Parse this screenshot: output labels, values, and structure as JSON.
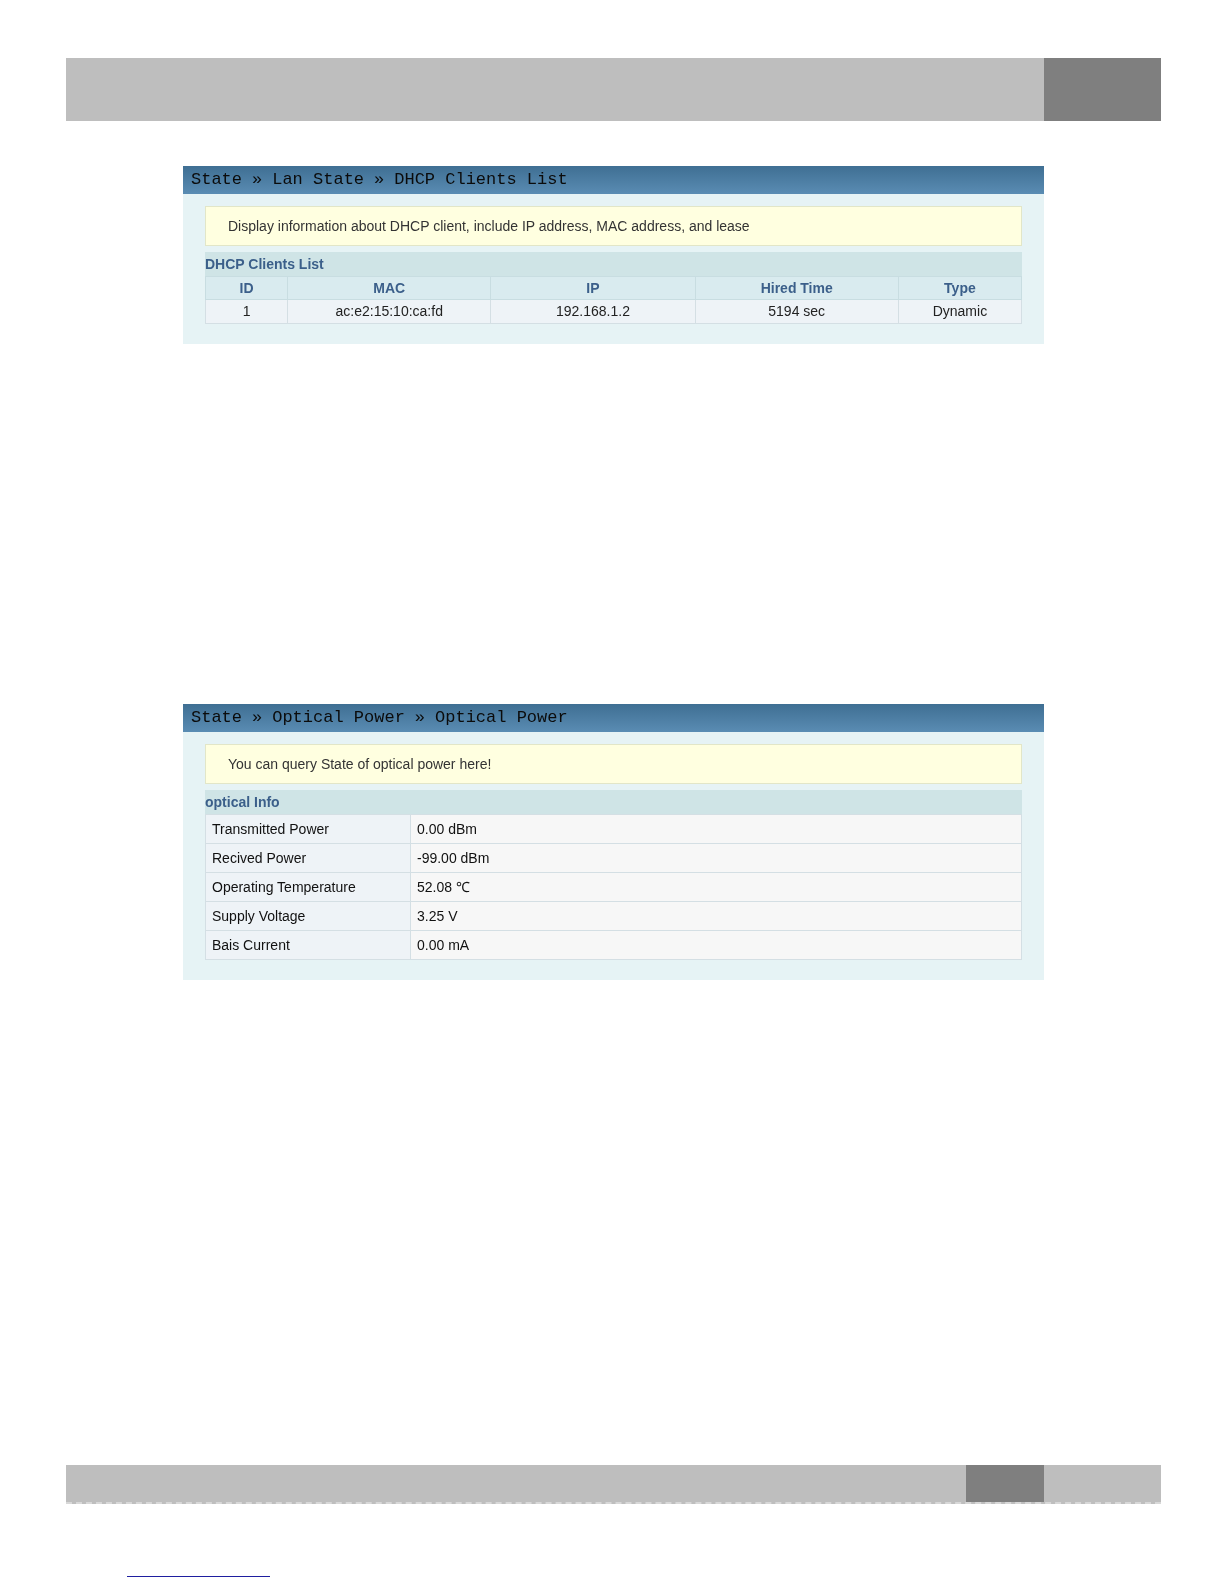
{
  "panels": [
    {
      "kind": "table",
      "breadcrumb": [
        "State",
        "Lan State",
        "DHCP Clients List"
      ],
      "separator": "»",
      "note": "Display information about DHCP client, include IP address, MAC address, and lease",
      "section": "DHCP Clients List",
      "columns": [
        "ID",
        "MAC",
        "IP",
        "Hired Time",
        "Type"
      ],
      "rows": [
        [
          "1",
          "ac:e2:15:10:ca:fd",
          "192.168.1.2",
          "5194 sec",
          "Dynamic"
        ]
      ]
    },
    {
      "kind": "info",
      "breadcrumb": [
        "State",
        "Optical Power",
        "Optical Power"
      ],
      "separator": "»",
      "note": "You can query State of optical power here!",
      "section": "optical Info",
      "rows": [
        [
          "Transmitted Power",
          "0.00 dBm"
        ],
        [
          "Recived Power",
          "-99.00 dBm"
        ],
        [
          "Operating Temperature",
          "52.08 ℃"
        ],
        [
          "Supply Voltage",
          "3.25 V"
        ],
        [
          "Bais Current",
          "0.00 mA"
        ]
      ]
    }
  ]
}
